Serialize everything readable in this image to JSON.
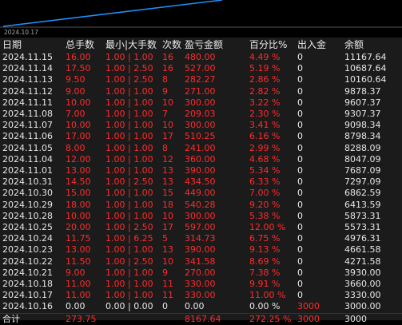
{
  "chart": {
    "start_date": "2024.10.17",
    "line_color": "#1e90ff"
  },
  "headers": {
    "date": "日期",
    "total_lots": "总手数",
    "min_max_lots": "最小|大手数",
    "count": "次数",
    "pnl": "盈亏金额",
    "pct": "百分比%",
    "deposit": "出入金",
    "balance": "余额"
  },
  "colors": {
    "background": "#1b1b1b",
    "red": "#ff2b2b",
    "text": "#e8e8e8"
  },
  "rows": [
    {
      "date": "2024.11.15",
      "total_lots": "16.00",
      "min_max": "1.00 | 1.00",
      "count": "16",
      "pnl": "480.00",
      "pct": "4.49 %",
      "deposit": "0",
      "balance": "11167.64"
    },
    {
      "date": "2024.11.14",
      "total_lots": "17.50",
      "min_max": "1.00 | 2.50",
      "count": "16",
      "pnl": "527.00",
      "pct": "5.19 %",
      "deposit": "0",
      "balance": "10687.64"
    },
    {
      "date": "2024.11.13",
      "total_lots": "9.50",
      "min_max": "1.00 | 2.50",
      "count": "8",
      "pnl": "282.27",
      "pct": "2.86 %",
      "deposit": "0",
      "balance": "10160.64"
    },
    {
      "date": "2024.11.12",
      "total_lots": "9.00",
      "min_max": "1.00 | 1.00",
      "count": "9",
      "pnl": "271.00",
      "pct": "2.82 %",
      "deposit": "0",
      "balance": "9878.37"
    },
    {
      "date": "2024.11.11",
      "total_lots": "10.00",
      "min_max": "1.00 | 1.00",
      "count": "10",
      "pnl": "300.00",
      "pct": "3.22 %",
      "deposit": "0",
      "balance": "9607.37"
    },
    {
      "date": "2024.11.08",
      "total_lots": "7.00",
      "min_max": "1.00 | 1.00",
      "count": "7",
      "pnl": "209.03",
      "pct": "2.30 %",
      "deposit": "0",
      "balance": "9307.37"
    },
    {
      "date": "2024.11.07",
      "total_lots": "10.00",
      "min_max": "1.00 | 1.00",
      "count": "10",
      "pnl": "300.00",
      "pct": "3.41 %",
      "deposit": "0",
      "balance": "9098.34"
    },
    {
      "date": "2024.11.06",
      "total_lots": "17.00",
      "min_max": "1.00 | 1.00",
      "count": "17",
      "pnl": "510.25",
      "pct": "6.16 %",
      "deposit": "0",
      "balance": "8798.34"
    },
    {
      "date": "2024.11.05",
      "total_lots": "8.00",
      "min_max": "1.00 | 1.00",
      "count": "8",
      "pnl": "241.00",
      "pct": "2.99 %",
      "deposit": "0",
      "balance": "8288.09"
    },
    {
      "date": "2024.11.04",
      "total_lots": "12.00",
      "min_max": "1.00 | 1.00",
      "count": "12",
      "pnl": "360.00",
      "pct": "4.68 %",
      "deposit": "0",
      "balance": "8047.09"
    },
    {
      "date": "2024.11.01",
      "total_lots": "13.00",
      "min_max": "1.00 | 1.00",
      "count": "13",
      "pnl": "390.00",
      "pct": "5.34 %",
      "deposit": "0",
      "balance": "7687.09"
    },
    {
      "date": "2024.10.31",
      "total_lots": "14.50",
      "min_max": "1.00 | 2.50",
      "count": "13",
      "pnl": "434.50",
      "pct": "6.33 %",
      "deposit": "0",
      "balance": "7297.09"
    },
    {
      "date": "2024.10.30",
      "total_lots": "15.00",
      "min_max": "1.00 | 1.00",
      "count": "15",
      "pnl": "449.00",
      "pct": "7.00 %",
      "deposit": "0",
      "balance": "6862.59"
    },
    {
      "date": "2024.10.29",
      "total_lots": "18.00",
      "min_max": "1.00 | 1.00",
      "count": "18",
      "pnl": "540.28",
      "pct": "9.20 %",
      "deposit": "0",
      "balance": "6413.59"
    },
    {
      "date": "2024.10.28",
      "total_lots": "10.00",
      "min_max": "1.00 | 1.00",
      "count": "10",
      "pnl": "300.00",
      "pct": "5.38 %",
      "deposit": "0",
      "balance": "5873.31"
    },
    {
      "date": "2024.10.25",
      "total_lots": "20.00",
      "min_max": "1.00 | 2.50",
      "count": "17",
      "pnl": "597.00",
      "pct": "12.00 %",
      "deposit": "0",
      "balance": "5573.31"
    },
    {
      "date": "2024.10.24",
      "total_lots": "11.75",
      "min_max": "1.00 | 6.25",
      "count": "5",
      "pnl": "314.73",
      "pct": "6.75 %",
      "deposit": "0",
      "balance": "4976.31"
    },
    {
      "date": "2024.10.23",
      "total_lots": "13.00",
      "min_max": "1.00 | 1.00",
      "count": "13",
      "pnl": "390.00",
      "pct": "9.13 %",
      "deposit": "0",
      "balance": "4661.58"
    },
    {
      "date": "2024.10.22",
      "total_lots": "11.50",
      "min_max": "1.00 | 2.50",
      "count": "10",
      "pnl": "341.58",
      "pct": "8.69 %",
      "deposit": "0",
      "balance": "4271.58"
    },
    {
      "date": "2024.10.21",
      "total_lots": "9.00",
      "min_max": "1.00 | 1.00",
      "count": "9",
      "pnl": "270.00",
      "pct": "7.38 %",
      "deposit": "0",
      "balance": "3930.00"
    },
    {
      "date": "2024.10.18",
      "total_lots": "11.00",
      "min_max": "1.00 | 1.00",
      "count": "11",
      "pnl": "330.00",
      "pct": "9.91 %",
      "deposit": "0",
      "balance": "3660.00"
    },
    {
      "date": "2024.10.17",
      "total_lots": "11.00",
      "min_max": "1.00 | 1.00",
      "count": "11",
      "pnl": "330.00",
      "pct": "11.00 %",
      "deposit": "0",
      "balance": "3330.00"
    },
    {
      "date": "2024.10.16",
      "total_lots": "0.00",
      "min_max": "0.00 | 0.00",
      "count": "0",
      "pnl": "0.00",
      "pct": "0.00 %",
      "deposit": "3000",
      "balance": "3000.00",
      "zero": true
    }
  ],
  "total": {
    "label": "合计",
    "total_lots": "273.75",
    "pnl": "8167.64",
    "pct": "272.25 %",
    "deposit": "3000",
    "balance": "3000"
  }
}
